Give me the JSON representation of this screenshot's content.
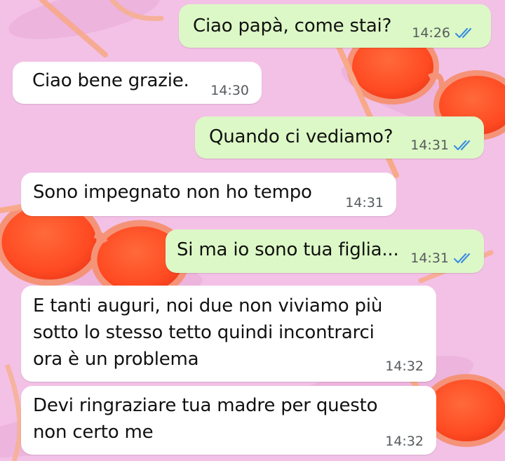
{
  "chat": {
    "theme": {
      "background_color": "#f2bfe4",
      "sent_bubble_color": "#dcf8c6",
      "received_bubble_color": "#ffffff",
      "read_ticks_color": "#3d8fe0",
      "wallpaper": "pink background with orange sunglasses"
    },
    "messages": [
      {
        "direction": "sent",
        "text": "Ciao papà, come stai?",
        "time": "14:26",
        "status": "read",
        "status_icon": "double-check-icon"
      },
      {
        "direction": "received",
        "text": "Ciao bene grazie.",
        "time": "14:30"
      },
      {
        "direction": "sent",
        "text": "Quando ci vediamo?",
        "time": "14:31",
        "status": "read",
        "status_icon": "double-check-icon"
      },
      {
        "direction": "received",
        "text": "Sono impegnato non ho tempo",
        "time": "14:31"
      },
      {
        "direction": "sent",
        "text": "Si ma io sono tua figlia...",
        "time": "14:31",
        "status": "read",
        "status_icon": "double-check-icon"
      },
      {
        "direction": "received",
        "text": "E tanti auguri, noi due non viviamo più\nsotto lo stesso tetto quindi incontrarci\nora è un problema",
        "time": "14:32"
      },
      {
        "direction": "received",
        "text": "Devi ringraziare tua madre per questo\nnon certo me",
        "time": "14:32"
      }
    ]
  }
}
